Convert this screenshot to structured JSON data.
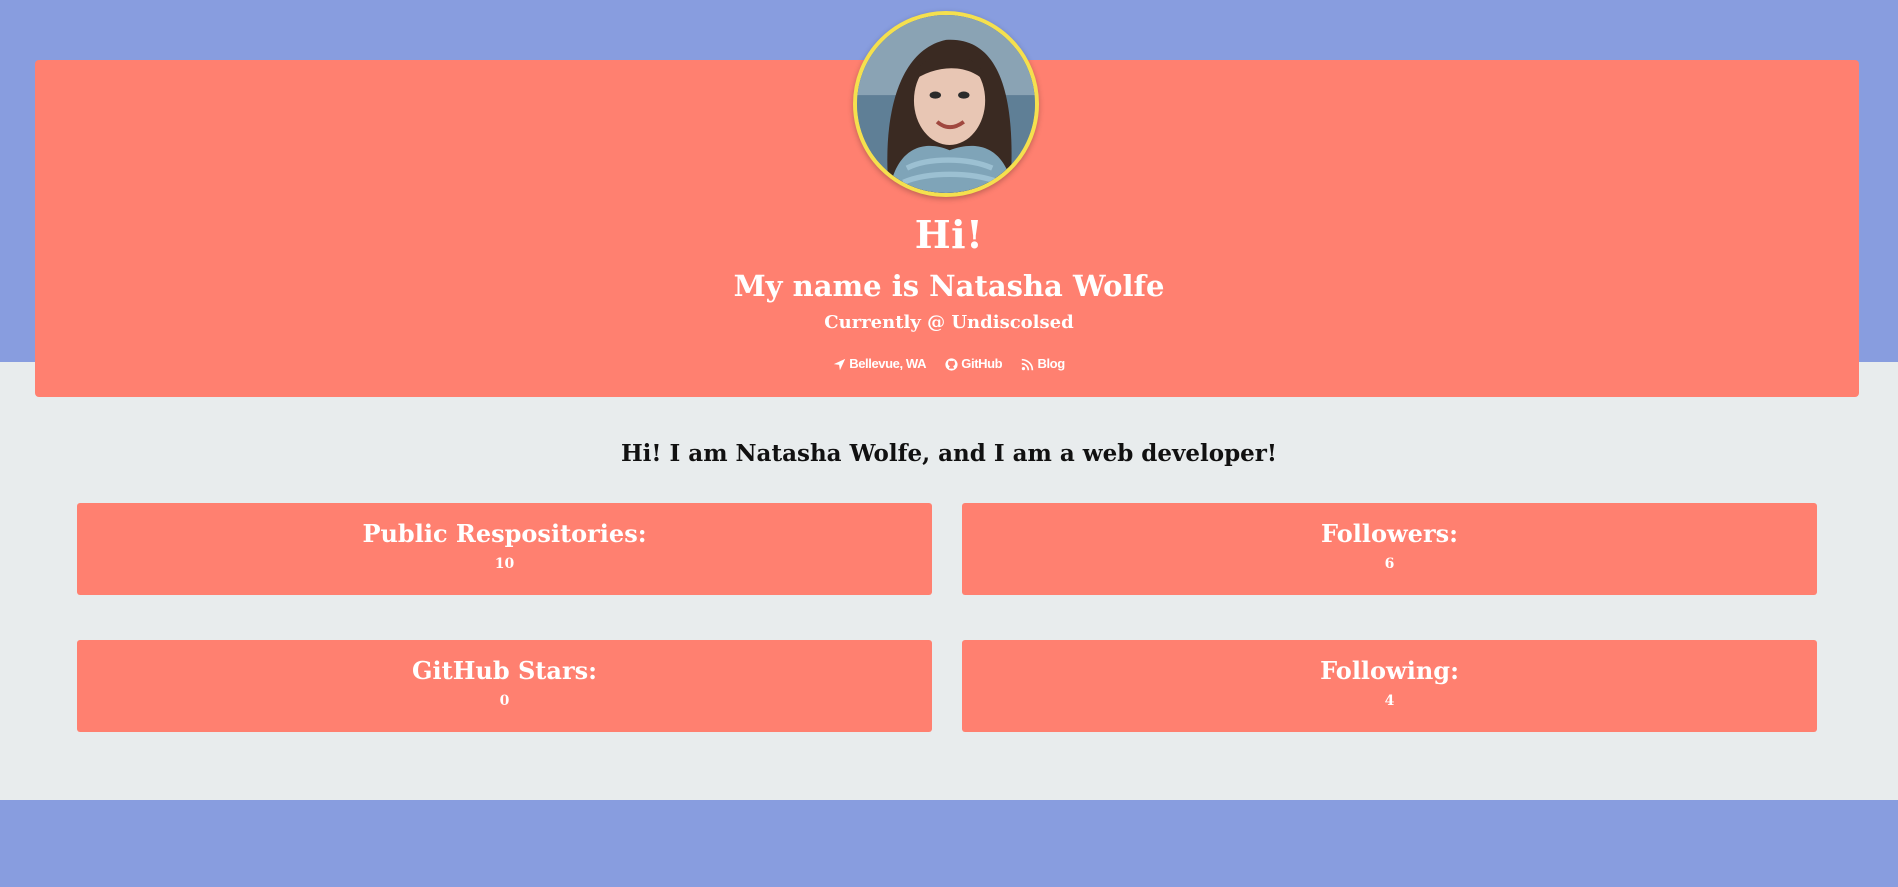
{
  "header": {
    "greeting": "Hi!",
    "name_line": "My name is Natasha Wolfe",
    "current_line": "Currently @ Undiscolsed",
    "links": [
      {
        "icon": "location-arrow-icon",
        "label": "Bellevue, WA"
      },
      {
        "icon": "github-icon",
        "label": "GitHub"
      },
      {
        "icon": "rss-icon",
        "label": "Blog"
      }
    ]
  },
  "intro": "Hi! I am Natasha Wolfe, and I am a web developer!",
  "stats": {
    "public_repos": {
      "label": "Public Respositories:",
      "value": "10"
    },
    "followers": {
      "label": "Followers:",
      "value": "6"
    },
    "github_stars": {
      "label": "GitHub Stars:",
      "value": "0"
    },
    "following": {
      "label": "Following:",
      "value": "4"
    }
  },
  "colors": {
    "band": "#889ddf",
    "card": "#ff8070",
    "page_background": "#e8eced",
    "avatar_border": "#f5e04e"
  }
}
